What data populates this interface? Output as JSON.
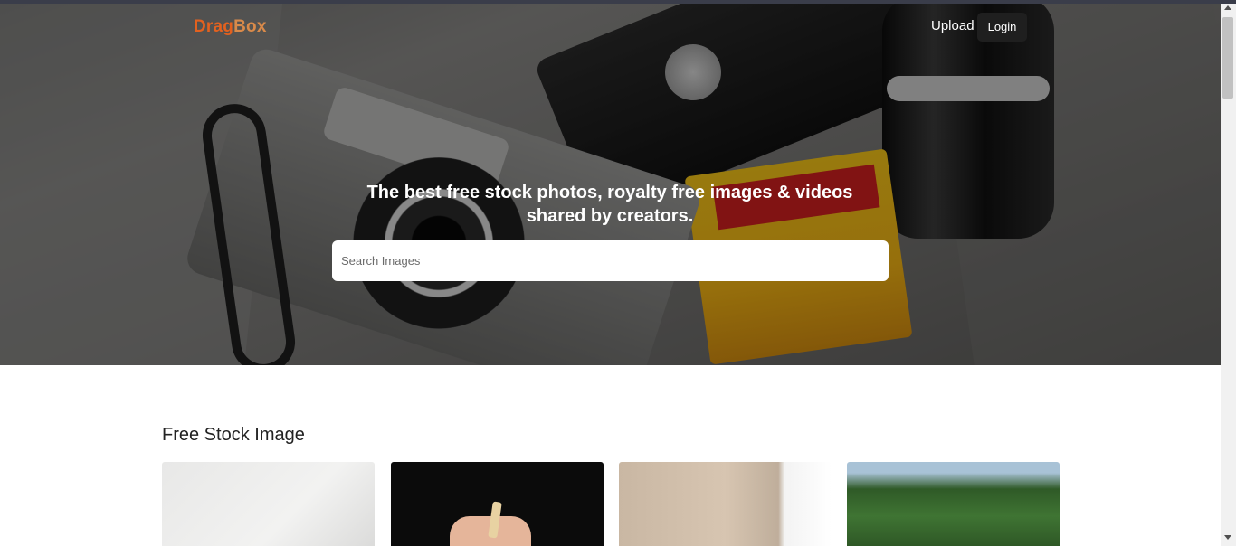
{
  "brand": {
    "part1": "Drag",
    "part2": "Box"
  },
  "nav": {
    "upload_label": "Upload",
    "login_label": "Login"
  },
  "hero": {
    "title": "The best free stock photos, royalty free images & videos shared by creators.",
    "search_placeholder": "Search Images"
  },
  "section": {
    "title": "Free Stock Image"
  },
  "colors": {
    "brand_accent": "#e2611f",
    "login_bg": "#1f1f1f"
  },
  "cards": [
    {
      "name": "stock-image-card-1"
    },
    {
      "name": "stock-image-card-2"
    },
    {
      "name": "stock-image-card-3"
    },
    {
      "name": "stock-image-card-4"
    }
  ]
}
